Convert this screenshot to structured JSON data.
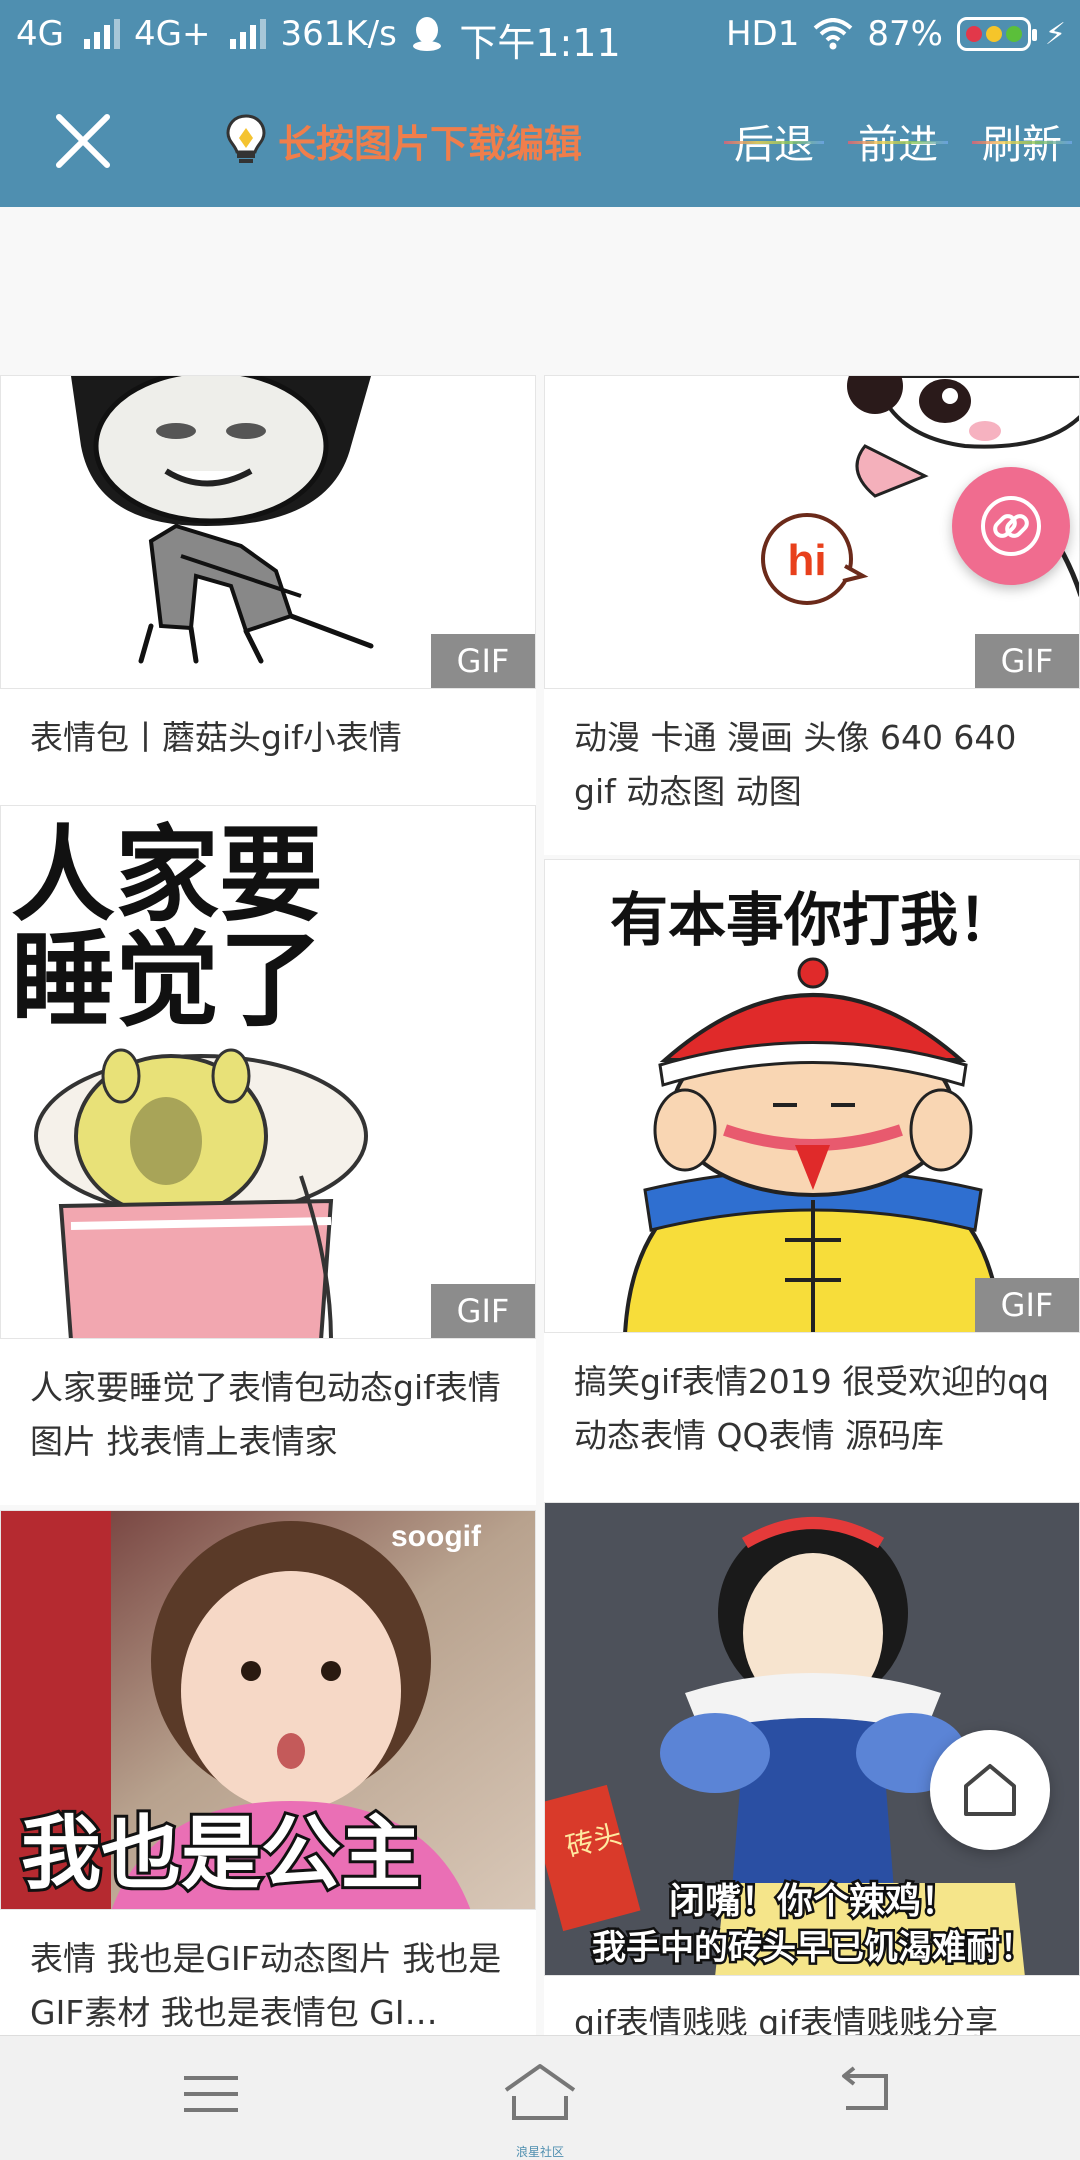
{
  "status_bar": {
    "net1": "4G",
    "net2": "4G+",
    "speed": "361K/s",
    "time": "下午1:11",
    "hd": "HD1",
    "battery": "87%"
  },
  "toolbar": {
    "hint": "长按图片下载编辑",
    "back": "后退",
    "forward": "前进",
    "refresh": "刷新"
  },
  "cards": [
    {
      "caption": "表情包丨蘑菇头gif小表情",
      "badge": "GIF"
    },
    {
      "caption": "动漫 卡通 漫画 头像 640 640 gif 动态图 动图",
      "badge": "GIF",
      "image_text": "hi"
    },
    {
      "caption": "人家要睡觉了表情包动态gif表情图片 找表情上表情家",
      "badge": "GIF",
      "image_text": "人家要睡觉了"
    },
    {
      "caption": "搞笑gif表情2019 很受欢迎的qq动态表情 QQ表情 源码库",
      "badge": "GIF",
      "image_text": "有本事你打我！"
    },
    {
      "caption": "表情 我也是GIF动态图片 我也是GIF素材 我也是表情包 GI…",
      "image_text": "我也是公主",
      "watermark": "soogif"
    },
    {
      "caption": "gif表情贱贱 gif表情贱贱分享",
      "image_text": "闭嘴！你个辣鸡！",
      "image_text2": "我手中的砖头早已饥渴难耐！",
      "brick_text": "砖头"
    }
  ],
  "bottom_nav": {
    "home_label": "浪星社区"
  },
  "colors": {
    "header_blue": "#4f8fb0",
    "hint_orange": "#f07e4b",
    "fab_pink": "#f06c8f",
    "badge_gray": "#8c8c8c"
  },
  "icons": [
    "close-icon",
    "lightbulb-icon",
    "link-icon",
    "home-icon",
    "menu-icon",
    "back-icon",
    "wifi-icon",
    "qq-icon"
  ]
}
